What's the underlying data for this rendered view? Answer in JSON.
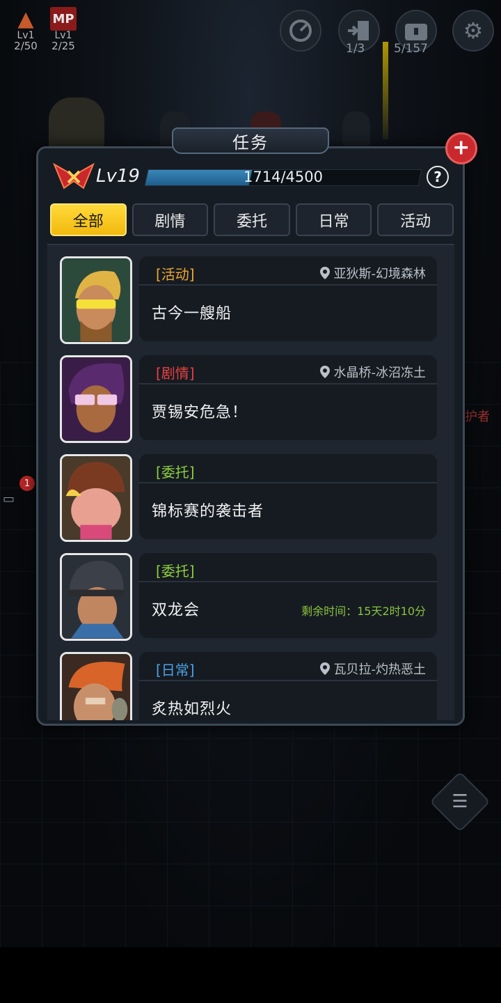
{
  "hud": {
    "stats": [
      {
        "icon": "flame-icon",
        "level": "Lv1",
        "count": "2/50"
      },
      {
        "icon": "mp-icon",
        "label": "MP",
        "level": "Lv1",
        "count": "2/25"
      }
    ],
    "buttons": [
      {
        "icon": "radar-icon",
        "count": ""
      },
      {
        "icon": "exit-door-icon",
        "count": "1/3"
      },
      {
        "icon": "chest-icon",
        "count": "5/157"
      },
      {
        "icon": "gear-icon",
        "count": ""
      }
    ]
  },
  "modal": {
    "title": "任务",
    "close_glyph": "+",
    "level": "Lv19",
    "xp": {
      "current": 1714,
      "max": 4500,
      "text": "1714/4500"
    },
    "help_glyph": "?",
    "tabs": [
      {
        "label": "全部",
        "active": true
      },
      {
        "label": "剧情",
        "active": false
      },
      {
        "label": "委托",
        "active": false
      },
      {
        "label": "日常",
        "active": false
      },
      {
        "label": "活动",
        "active": false
      }
    ],
    "quests": [
      {
        "type": "[活动]",
        "type_color": "#f0a92a",
        "location": "亚狄斯-幻境森林",
        "name": "古今一艘船",
        "time": ""
      },
      {
        "type": "[剧情]",
        "type_color": "#e84040",
        "location": "水晶桥-冰沼冻土",
        "name": "贾锡安危急！",
        "time": ""
      },
      {
        "type": "[委托]",
        "type_color": "#8ccf3c",
        "location": "",
        "name": "锦标赛的袭击者",
        "time": ""
      },
      {
        "type": "[委托]",
        "type_color": "#8ccf3c",
        "location": "",
        "name": "双龙会",
        "time": "剩余时间：15天2时10分"
      },
      {
        "type": "[日常]",
        "type_color": "#4aa3e6",
        "location": "瓦贝拉-灼热恶土",
        "name": "炙热如烈火",
        "time": ""
      }
    ]
  },
  "side": {
    "badge": "1",
    "label": "护者"
  }
}
